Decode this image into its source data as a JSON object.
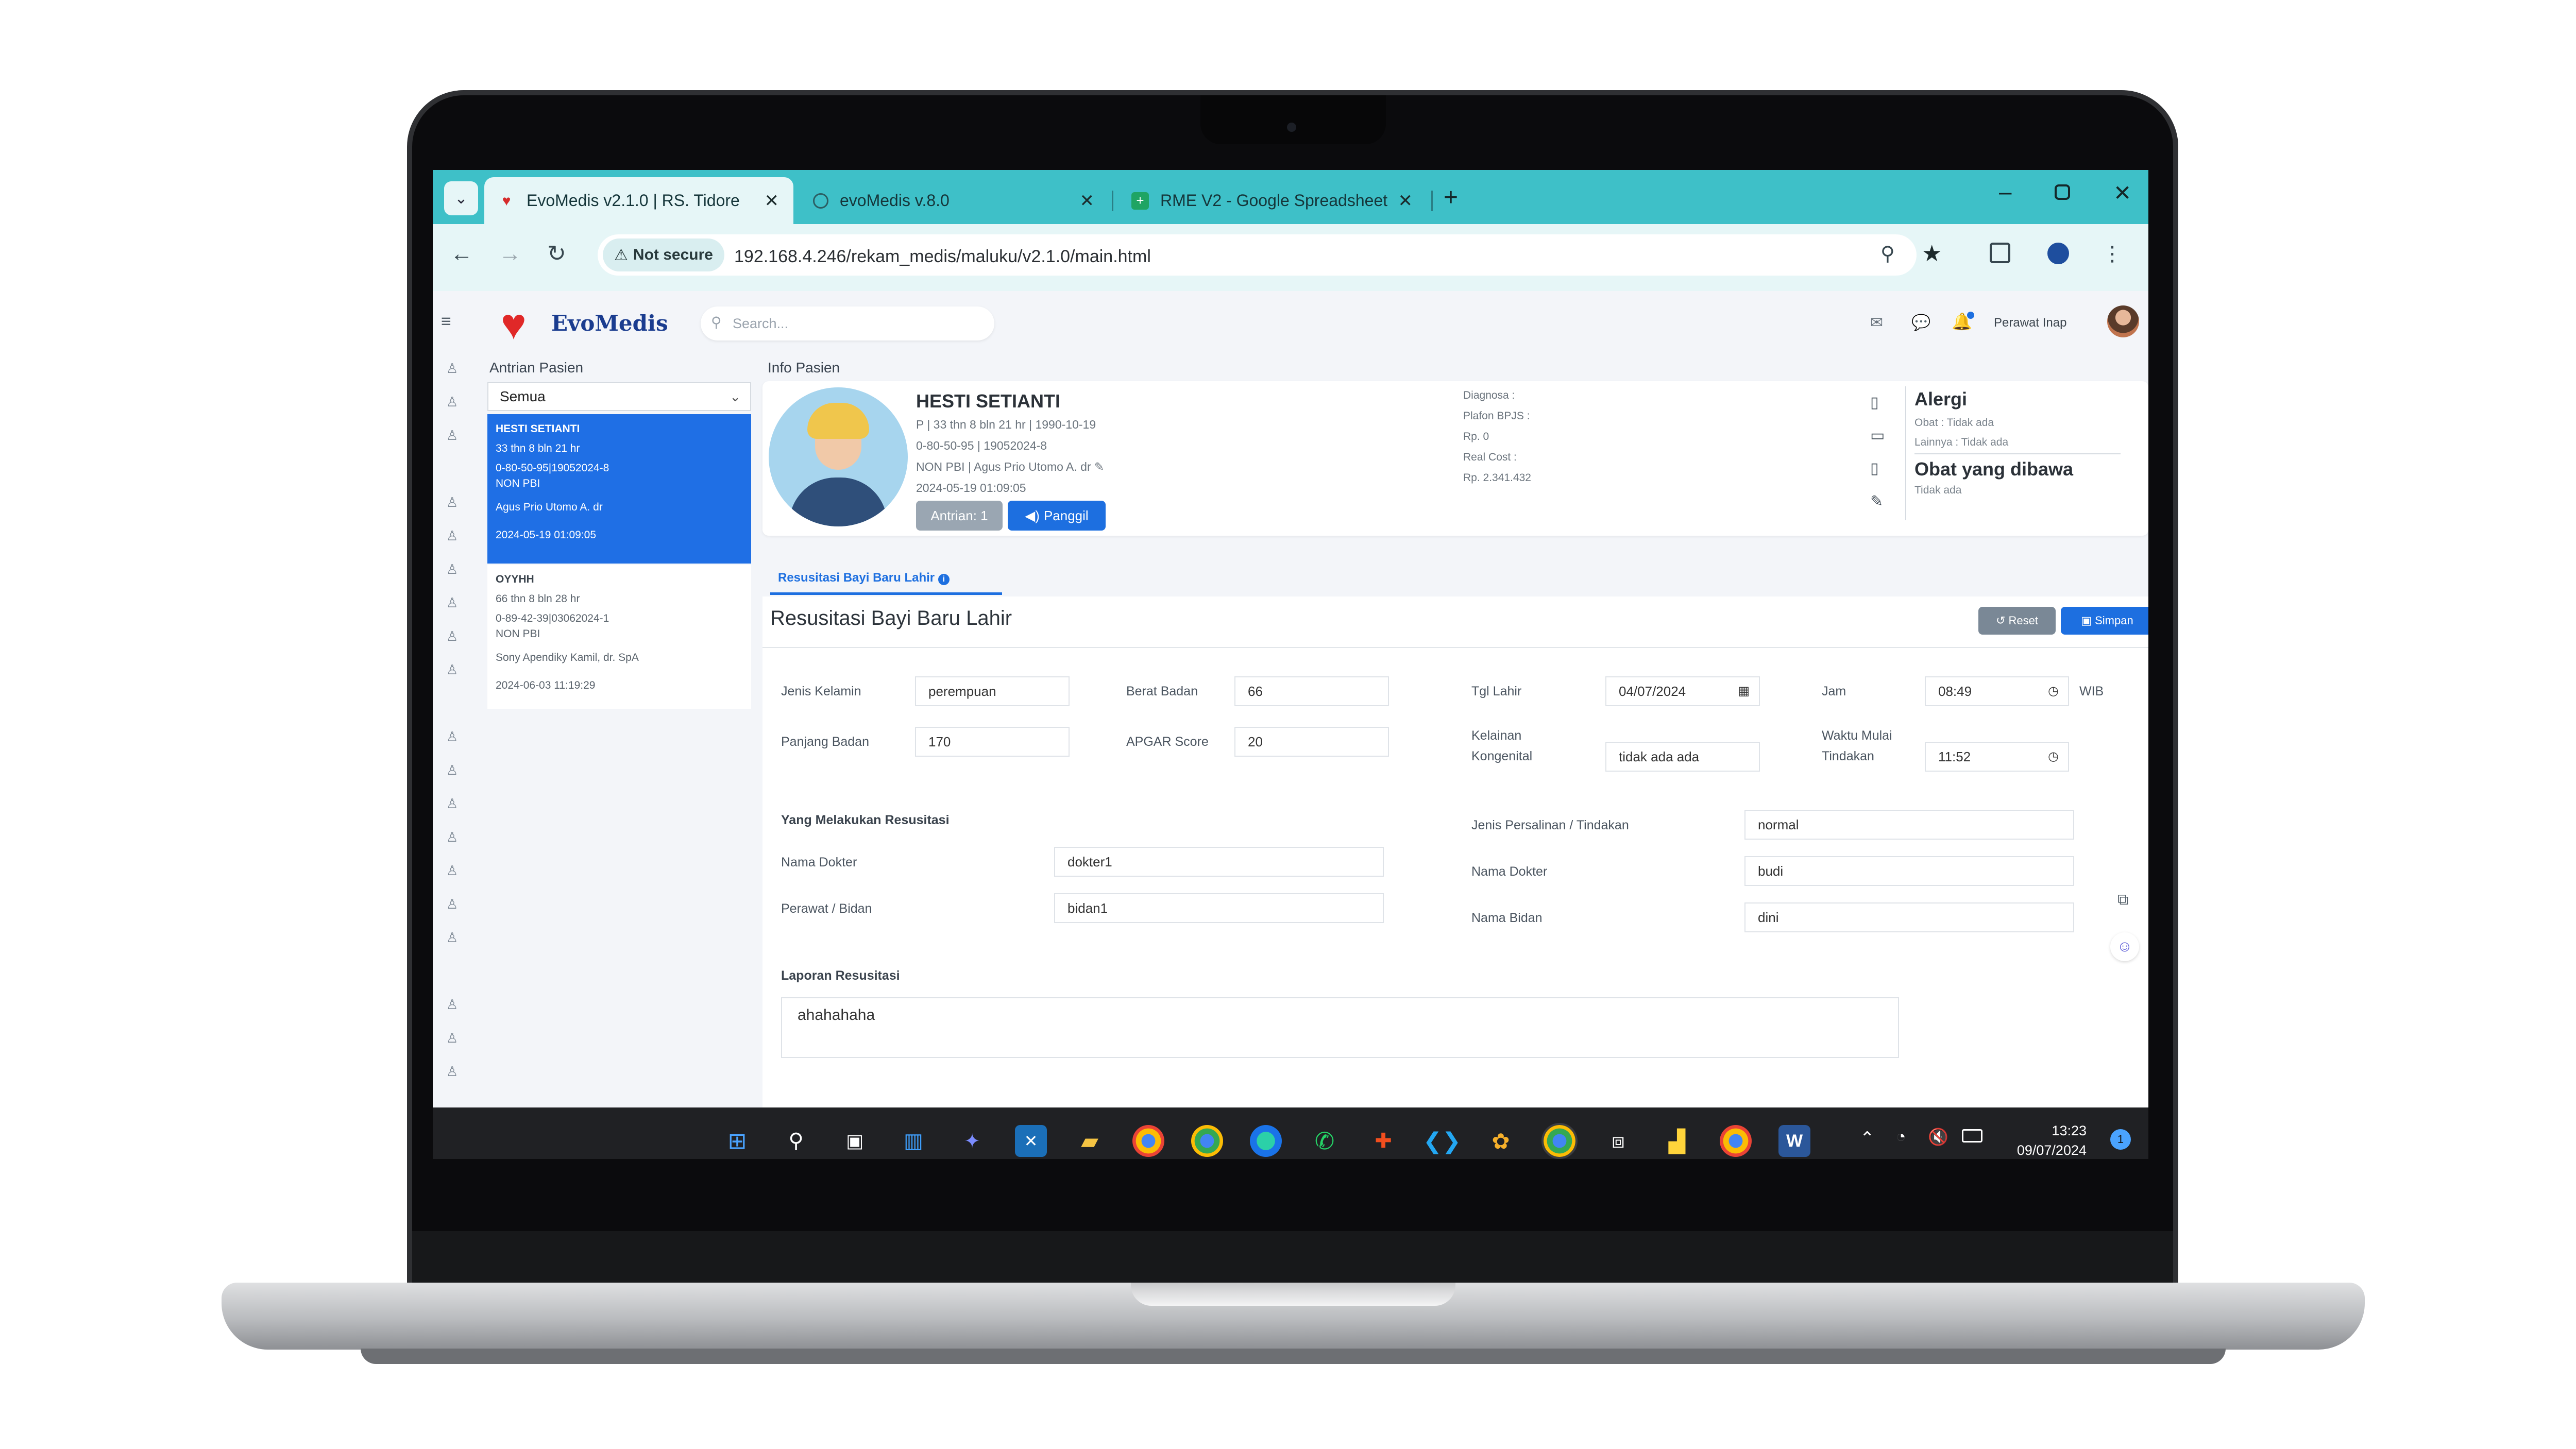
{
  "browser": {
    "tabs": [
      {
        "label": "EvoMedis v2.1.0 | RS. Tidore",
        "active": true
      },
      {
        "label": "evoMedis v.8.0",
        "active": false
      },
      {
        "label": "RME V2 - Google Spreadsheet",
        "active": false
      }
    ],
    "new_tab": "+",
    "not_secure": "Not secure",
    "url": "192.168.4.246/rekam_medis/maluku/v2.1.0/main.html"
  },
  "app": {
    "logo": "EvoMedis",
    "search_placeholder": "Search...",
    "user_role": "Perawat Inap"
  },
  "queue": {
    "title": "Antrian Pasien",
    "filter": "Semua",
    "patients": [
      {
        "name": "HESTI SETIANTI",
        "age": "33 thn 8 bln 21 hr",
        "ids": "0-80-50-95|19052024-8",
        "payer": "NON PBI",
        "doctor": "Agus Prio Utomo A. dr",
        "datetime": "2024-05-19 01:09:05",
        "selected": true
      },
      {
        "name": "OYYHH",
        "age": "66 thn 8 bln 28 hr",
        "ids": "0-89-42-39|03062024-1",
        "payer": "NON PBI",
        "doctor": "Sony Apendiky Kamil, dr. SpA",
        "datetime": "2024-06-03 11:19:29",
        "selected": false
      }
    ]
  },
  "patient_info": {
    "title": "Info Pasien",
    "name": "HESTI SETIANTI",
    "line1": "P | 33 thn 8 bln 21 hr | 1990-10-19",
    "line2": "0-80-50-95 | 19052024-8",
    "line3": "NON PBI | Agus Prio Utomo A. dr",
    "line4": "2024-05-19 01:09:05",
    "antrian_btn": "Antrian: 1",
    "panggil_btn": "Panggil",
    "diagnosa": "Diagnosa :",
    "plafon": "Plafon BPJS :",
    "rp1": "Rp. 0",
    "real_cost": "Real Cost :",
    "rp2": "Rp. 2.341.432",
    "alergi_title": "Alergi",
    "alergi_obat": "Obat : Tidak ada",
    "alergi_lainnya": "Lainnya : Tidak ada",
    "obat_title": "Obat yang dibawa",
    "obat_value": "Tidak ada"
  },
  "form": {
    "tab_label": "Resusitasi Bayi Baru Lahir",
    "title": "Resusitasi Bayi Baru Lahir",
    "reset_btn": "Reset",
    "save_btn": "Simpan",
    "fields": {
      "jenis_kelamin": {
        "label": "Jenis Kelamin",
        "value": "perempuan"
      },
      "berat_badan": {
        "label": "Berat Badan",
        "value": "66"
      },
      "tgl_lahir": {
        "label": "Tgl Lahir",
        "value": "04/07/2024"
      },
      "jam": {
        "label": "Jam",
        "value": "08:49",
        "unit": "WIB"
      },
      "panjang_badan": {
        "label": "Panjang Badan",
        "value": "170"
      },
      "apgar": {
        "label": "APGAR Score",
        "value": "20"
      },
      "kelainan_1": "Kelainan",
      "kelainan_2": "Kongenital",
      "kelainan_value": "tidak ada ada",
      "waktu_1": "Waktu Mulai",
      "waktu_2": "Tindakan",
      "waktu_value": "11:52"
    },
    "section_resusitasi": "Yang Melakukan Resusitasi",
    "nama_dokter": {
      "label": "Nama Dokter",
      "value": "dokter1"
    },
    "perawat": {
      "label": "Perawat / Bidan",
      "value": "bidan1"
    },
    "jenis_persalinan": {
      "label": "Jenis Persalinan / Tindakan",
      "value": "normal"
    },
    "nama_dokter2": {
      "label": "Nama Dokter",
      "value": "budi"
    },
    "nama_bidan": {
      "label": "Nama Bidan",
      "value": "dini"
    },
    "laporan_title": "Laporan Resusitasi",
    "laporan_value": "ahahahaha"
  },
  "taskbar": {
    "time": "13:23",
    "date": "09/07/2024",
    "badge": "1"
  },
  "colors": {
    "tabbar": "#3ec0c8",
    "primary": "#1d6fe0",
    "selected_card": "#1f6fe5",
    "reset_btn": "#7a8896"
  }
}
